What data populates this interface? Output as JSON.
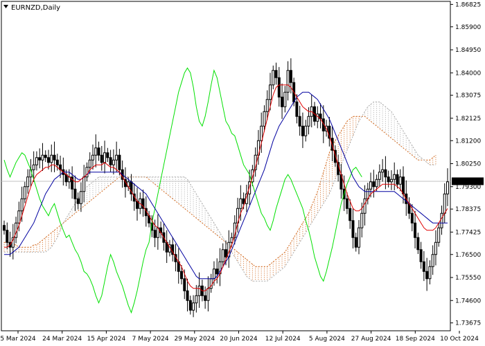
{
  "window": {
    "title": "EURNZD,Daily",
    "menu_icon": "triangle-down-icon"
  },
  "colors": {
    "candle": "#000000",
    "tenkan": "#e00000",
    "kijun": "#0000a0",
    "chikou": "#00e000",
    "cloud_bear": "#d2691e",
    "cloud_bull": "#a9a9a9",
    "price_line": "#c0c0c0",
    "price_tag_bg": "#000000",
    "price_tag_text": "#ffffff"
  },
  "chart_data": {
    "type": "candlestick",
    "symbol": "EURNZD",
    "timeframe": "Daily",
    "indicators": [
      "Ichimoku Kinko Hyo: Tenkan-sen",
      "Kijun-sen",
      "Chikou Span",
      "Senkou Span A",
      "Senkou Span B"
    ],
    "ylim": [
      1.7335,
      1.8695
    ],
    "y_ticks": [
      "1.86825",
      "1.85900",
      "1.84950",
      "1.84000",
      "1.83075",
      "1.82125",
      "1.81200",
      "1.80250",
      "1.79300",
      "1.78375",
      "1.77425",
      "1.76500",
      "1.75550",
      "1.74600",
      "1.73675"
    ],
    "x_ticks": [
      "5 Mar 2024",
      "24 Mar 2024",
      "15 Apr 2024",
      "7 May 2024",
      "29 May 2024",
      "20 Jun 2024",
      "12 Jul 2024",
      "5 Aug 2024",
      "27 Aug 2024",
      "18 Sep 2024",
      "10 Oct 2024"
    ],
    "current_price": "1.79523",
    "close": [
      1.775,
      1.77,
      1.768,
      1.772,
      1.778,
      1.783,
      1.788,
      1.793,
      1.797,
      1.8,
      1.802,
      1.805,
      1.804,
      1.806,
      1.805,
      1.803,
      1.806,
      1.804,
      1.802,
      1.8,
      1.798,
      1.795,
      1.797,
      1.792,
      1.788,
      1.786,
      1.791,
      1.797,
      1.801,
      1.804,
      1.806,
      1.809,
      1.806,
      1.803,
      1.807,
      1.805,
      1.802,
      1.804,
      1.806,
      1.8,
      1.796,
      1.793,
      1.795,
      1.79,
      1.787,
      1.784,
      1.788,
      1.784,
      1.781,
      1.778,
      1.775,
      1.772,
      1.776,
      1.774,
      1.77,
      1.766,
      1.769,
      1.765,
      1.762,
      1.758,
      1.755,
      1.75,
      1.746,
      1.742,
      1.745,
      1.748,
      1.752,
      1.748,
      1.746,
      1.751,
      1.755,
      1.759,
      1.757,
      1.762,
      1.767,
      1.764,
      1.77,
      1.772,
      1.778,
      1.784,
      1.788,
      1.786,
      1.79,
      1.795,
      1.8,
      1.806,
      1.812,
      1.818,
      1.824,
      1.829,
      1.835,
      1.841,
      1.838,
      1.83,
      1.826,
      1.832,
      1.841,
      1.836,
      1.828,
      1.822,
      1.818,
      1.814,
      1.818,
      1.822,
      1.826,
      1.82,
      1.823,
      1.821,
      1.816,
      1.818,
      1.813,
      1.808,
      1.803,
      1.798,
      1.792,
      1.788,
      1.784,
      1.779,
      1.772,
      1.768,
      1.776,
      1.782,
      1.788,
      1.792,
      1.795,
      1.793,
      1.796,
      1.799,
      1.8,
      1.797,
      1.795,
      1.796,
      1.798,
      1.794,
      1.797,
      1.79,
      1.786,
      1.782,
      1.778,
      1.772,
      1.767,
      1.762,
      1.758,
      1.755,
      1.76,
      1.765,
      1.77,
      1.776,
      1.782,
      1.79,
      1.795
    ],
    "tenkan_sen": [
      1.768,
      1.768,
      1.769,
      1.771,
      1.774,
      1.777,
      1.781,
      1.785,
      1.789,
      1.793,
      1.796,
      1.798,
      1.799,
      1.8,
      1.801,
      1.801,
      1.802,
      1.802,
      1.801,
      1.8,
      1.799,
      1.798,
      1.797,
      1.796,
      1.795,
      1.795,
      1.796,
      1.797,
      1.798,
      1.8,
      1.801,
      1.802,
      1.802,
      1.802,
      1.803,
      1.802,
      1.801,
      1.801,
      1.8,
      1.799,
      1.797,
      1.795,
      1.793,
      1.791,
      1.789,
      1.787,
      1.786,
      1.785,
      1.783,
      1.781,
      1.779,
      1.777,
      1.776,
      1.774,
      1.772,
      1.77,
      1.768,
      1.766,
      1.764,
      1.762,
      1.76,
      1.757,
      1.754,
      1.752,
      1.751,
      1.751,
      1.751,
      1.75,
      1.75,
      1.751,
      1.752,
      1.754,
      1.755,
      1.757,
      1.76,
      1.763,
      1.766,
      1.769,
      1.773,
      1.778,
      1.782,
      1.785,
      1.789,
      1.793,
      1.797,
      1.801,
      1.806,
      1.811,
      1.816,
      1.821,
      1.826,
      1.831,
      1.834,
      1.835,
      1.835,
      1.835,
      1.835,
      1.834,
      1.832,
      1.83,
      1.828,
      1.826,
      1.825,
      1.824,
      1.824,
      1.823,
      1.822,
      1.821,
      1.819,
      1.817,
      1.814,
      1.81,
      1.806,
      1.802,
      1.798,
      1.794,
      1.79,
      1.787,
      1.784,
      1.783,
      1.783,
      1.784,
      1.786,
      1.788,
      1.79,
      1.791,
      1.792,
      1.793,
      1.794,
      1.794,
      1.794,
      1.794,
      1.794,
      1.793,
      1.792,
      1.79,
      1.788,
      1.786,
      1.784,
      1.782,
      1.78,
      1.778,
      1.776,
      1.775,
      1.775,
      1.775,
      1.776,
      1.778,
      1.78,
      1.782,
      1.784
    ],
    "kijun_sen": [
      1.765,
      1.765,
      1.765,
      1.766,
      1.767,
      1.768,
      1.77,
      1.772,
      1.774,
      1.776,
      1.778,
      1.781,
      1.784,
      1.787,
      1.79,
      1.792,
      1.794,
      1.796,
      1.797,
      1.798,
      1.799,
      1.799,
      1.799,
      1.798,
      1.797,
      1.796,
      1.796,
      1.797,
      1.798,
      1.799,
      1.799,
      1.799,
      1.799,
      1.799,
      1.799,
      1.799,
      1.799,
      1.799,
      1.799,
      1.799,
      1.798,
      1.797,
      1.796,
      1.795,
      1.794,
      1.793,
      1.792,
      1.791,
      1.79,
      1.788,
      1.786,
      1.784,
      1.782,
      1.78,
      1.778,
      1.776,
      1.774,
      1.772,
      1.77,
      1.768,
      1.766,
      1.764,
      1.762,
      1.76,
      1.758,
      1.756,
      1.755,
      1.755,
      1.755,
      1.755,
      1.755,
      1.755,
      1.756,
      1.758,
      1.76,
      1.762,
      1.764,
      1.767,
      1.77,
      1.773,
      1.776,
      1.779,
      1.782,
      1.785,
      1.788,
      1.791,
      1.794,
      1.797,
      1.8,
      1.804,
      1.808,
      1.812,
      1.815,
      1.818,
      1.82,
      1.822,
      1.824,
      1.826,
      1.828,
      1.83,
      1.831,
      1.832,
      1.832,
      1.832,
      1.831,
      1.83,
      1.829,
      1.827,
      1.825,
      1.823,
      1.821,
      1.818,
      1.815,
      1.812,
      1.809,
      1.806,
      1.803,
      1.8,
      1.797,
      1.795,
      1.793,
      1.792,
      1.791,
      1.791,
      1.791,
      1.791,
      1.791,
      1.791,
      1.791,
      1.791,
      1.791,
      1.791,
      1.791,
      1.79,
      1.789,
      1.788,
      1.787,
      1.786,
      1.785,
      1.784,
      1.783,
      1.782,
      1.781,
      1.78,
      1.779,
      1.778,
      1.778,
      1.778,
      1.778,
      1.778,
      1.778
    ],
    "chikou_span": [
      1.804,
      1.8,
      1.797,
      1.8,
      1.803,
      1.805,
      1.807,
      1.806,
      1.803,
      1.8,
      1.796,
      1.792,
      1.788,
      1.785,
      1.783,
      1.781,
      1.784,
      1.786,
      1.782,
      1.778,
      1.775,
      1.772,
      1.773,
      1.77,
      1.767,
      1.765,
      1.762,
      1.758,
      1.757,
      1.755,
      1.752,
      1.748,
      1.745,
      1.748,
      1.754,
      1.76,
      1.765,
      1.762,
      1.758,
      1.755,
      1.752,
      1.748,
      1.744,
      1.741,
      1.745,
      1.75,
      1.756,
      1.762,
      1.767,
      1.77,
      1.778,
      1.784,
      1.79,
      1.796,
      1.802,
      1.808,
      1.814,
      1.82,
      1.826,
      1.832,
      1.836,
      1.84,
      1.842,
      1.84,
      1.834,
      1.826,
      1.82,
      1.818,
      1.822,
      1.828,
      1.835,
      1.841,
      1.838,
      1.832,
      1.826,
      1.82,
      1.818,
      1.815,
      1.814,
      1.81,
      1.806,
      1.802,
      1.8,
      1.798,
      1.794,
      1.79,
      1.786,
      1.782,
      1.78,
      1.777,
      1.775,
      1.779,
      1.784,
      1.788,
      1.792,
      1.796,
      1.798,
      1.796,
      1.793,
      1.79,
      1.787,
      1.784,
      1.779,
      1.775,
      1.77,
      1.764,
      1.76,
      1.756,
      1.754,
      1.758,
      1.763,
      1.768,
      1.774,
      1.78,
      1.786,
      1.79,
      1.794,
      1.797,
      1.8,
      1.801,
      1.799,
      1.797
    ],
    "senkou_a": [
      1.77,
      1.77,
      1.77,
      1.769,
      1.769,
      1.768,
      1.768,
      1.768,
      1.768,
      1.768,
      1.769,
      1.769,
      1.77,
      1.771,
      1.772,
      1.773,
      1.774,
      1.775,
      1.776,
      1.777,
      1.778,
      1.779,
      1.78,
      1.781,
      1.782,
      1.783,
      1.784,
      1.785,
      1.786,
      1.787,
      1.788,
      1.789,
      1.79,
      1.791,
      1.792,
      1.793,
      1.794,
      1.795,
      1.796,
      1.797,
      1.797,
      1.797,
      1.797,
      1.797,
      1.797,
      1.797,
      1.797,
      1.797,
      1.797,
      1.796,
      1.795,
      1.794,
      1.793,
      1.792,
      1.791,
      1.79,
      1.789,
      1.788,
      1.787,
      1.786,
      1.785,
      1.784,
      1.783,
      1.782,
      1.781,
      1.78,
      1.779,
      1.778,
      1.777,
      1.776,
      1.775,
      1.774,
      1.773,
      1.772,
      1.771,
      1.77,
      1.769,
      1.768,
      1.767,
      1.766,
      1.765,
      1.764,
      1.763,
      1.762,
      1.761,
      1.76,
      1.76,
      1.76,
      1.76,
      1.76,
      1.761,
      1.762,
      1.763,
      1.764,
      1.765,
      1.766,
      1.768,
      1.77,
      1.772,
      1.774,
      1.776,
      1.778,
      1.78,
      1.782,
      1.785,
      1.788,
      1.791,
      1.795,
      1.799,
      1.803,
      1.807,
      1.81,
      1.812,
      1.814,
      1.816,
      1.818,
      1.82,
      1.821,
      1.822,
      1.822,
      1.822,
      1.822,
      1.822,
      1.821,
      1.82,
      1.819,
      1.818,
      1.817,
      1.816,
      1.815,
      1.814,
      1.813,
      1.812,
      1.811,
      1.81,
      1.809,
      1.808,
      1.807,
      1.806,
      1.805,
      1.804,
      1.804,
      1.804,
      1.804,
      1.804,
      1.805,
      1.806
    ],
    "senkou_b": [
      1.766,
      1.766,
      1.766,
      1.766,
      1.766,
      1.766,
      1.766,
      1.766,
      1.766,
      1.766,
      1.766,
      1.766,
      1.766,
      1.766,
      1.766,
      1.767,
      1.768,
      1.77,
      1.772,
      1.775,
      1.778,
      1.78,
      1.782,
      1.784,
      1.786,
      1.788,
      1.79,
      1.792,
      1.793,
      1.794,
      1.795,
      1.796,
      1.797,
      1.797,
      1.797,
      1.797,
      1.797,
      1.797,
      1.797,
      1.797,
      1.797,
      1.797,
      1.797,
      1.797,
      1.797,
      1.797,
      1.797,
      1.797,
      1.797,
      1.797,
      1.797,
      1.797,
      1.797,
      1.797,
      1.797,
      1.797,
      1.797,
      1.797,
      1.797,
      1.797,
      1.797,
      1.797,
      1.796,
      1.794,
      1.792,
      1.79,
      1.788,
      1.786,
      1.784,
      1.782,
      1.78,
      1.778,
      1.776,
      1.774,
      1.772,
      1.77,
      1.768,
      1.766,
      1.764,
      1.762,
      1.76,
      1.758,
      1.756,
      1.755,
      1.754,
      1.754,
      1.754,
      1.754,
      1.754,
      1.754,
      1.755,
      1.756,
      1.757,
      1.758,
      1.759,
      1.76,
      1.762,
      1.764,
      1.766,
      1.768,
      1.77,
      1.772,
      1.774,
      1.776,
      1.778,
      1.78,
      1.782,
      1.784,
      1.786,
      1.788,
      1.79,
      1.793,
      1.796,
      1.799,
      1.802,
      1.805,
      1.808,
      1.811,
      1.814,
      1.817,
      1.82,
      1.822,
      1.824,
      1.826,
      1.827,
      1.828,
      1.828,
      1.828,
      1.827,
      1.826,
      1.825,
      1.824,
      1.822,
      1.82,
      1.818,
      1.816,
      1.814,
      1.812,
      1.81,
      1.808,
      1.806,
      1.805,
      1.804,
      1.803,
      1.802,
      1.802,
      1.802
    ]
  }
}
